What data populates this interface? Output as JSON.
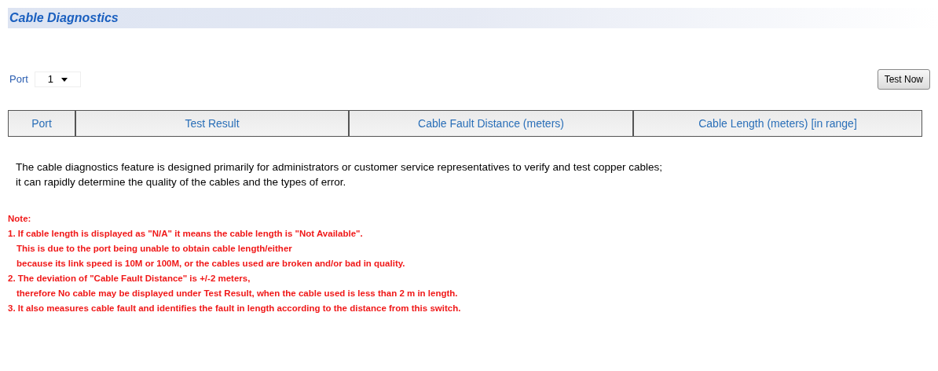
{
  "title": "Cable Diagnostics",
  "port_select": {
    "label": "Port",
    "value": "1"
  },
  "test_button": "Test Now",
  "table": {
    "columns": [
      "Port",
      "Test Result",
      "Cable Fault Distance (meters)",
      "Cable Length (meters) [in range]"
    ]
  },
  "description": [
    "The cable diagnostics feature is designed primarily for administrators or customer service representatives to verify and test copper cables;",
    "it can rapidly determine the quality of the cables and the types of error."
  ],
  "note": {
    "heading": "Note:",
    "lines": [
      {
        "kind": "item",
        "text": "1. If cable length is displayed as \"N/A\" it means the cable length is \"Not Available\"."
      },
      {
        "kind": "cont",
        "text": "This is due to the port being unable to obtain cable length/either"
      },
      {
        "kind": "cont",
        "text": "because its link speed is 10M or 100M, or the cables used are broken and/or bad in quality."
      },
      {
        "kind": "item",
        "text": "2. The deviation of \"Cable Fault Distance\" is +/-2 meters,"
      },
      {
        "kind": "cont",
        "text": "therefore No cable may be displayed under Test Result, when the cable used is less than 2 m in length."
      },
      {
        "kind": "item",
        "text": "3. It also measures cable fault and identifies the fault in length according to the distance from this switch."
      }
    ]
  }
}
